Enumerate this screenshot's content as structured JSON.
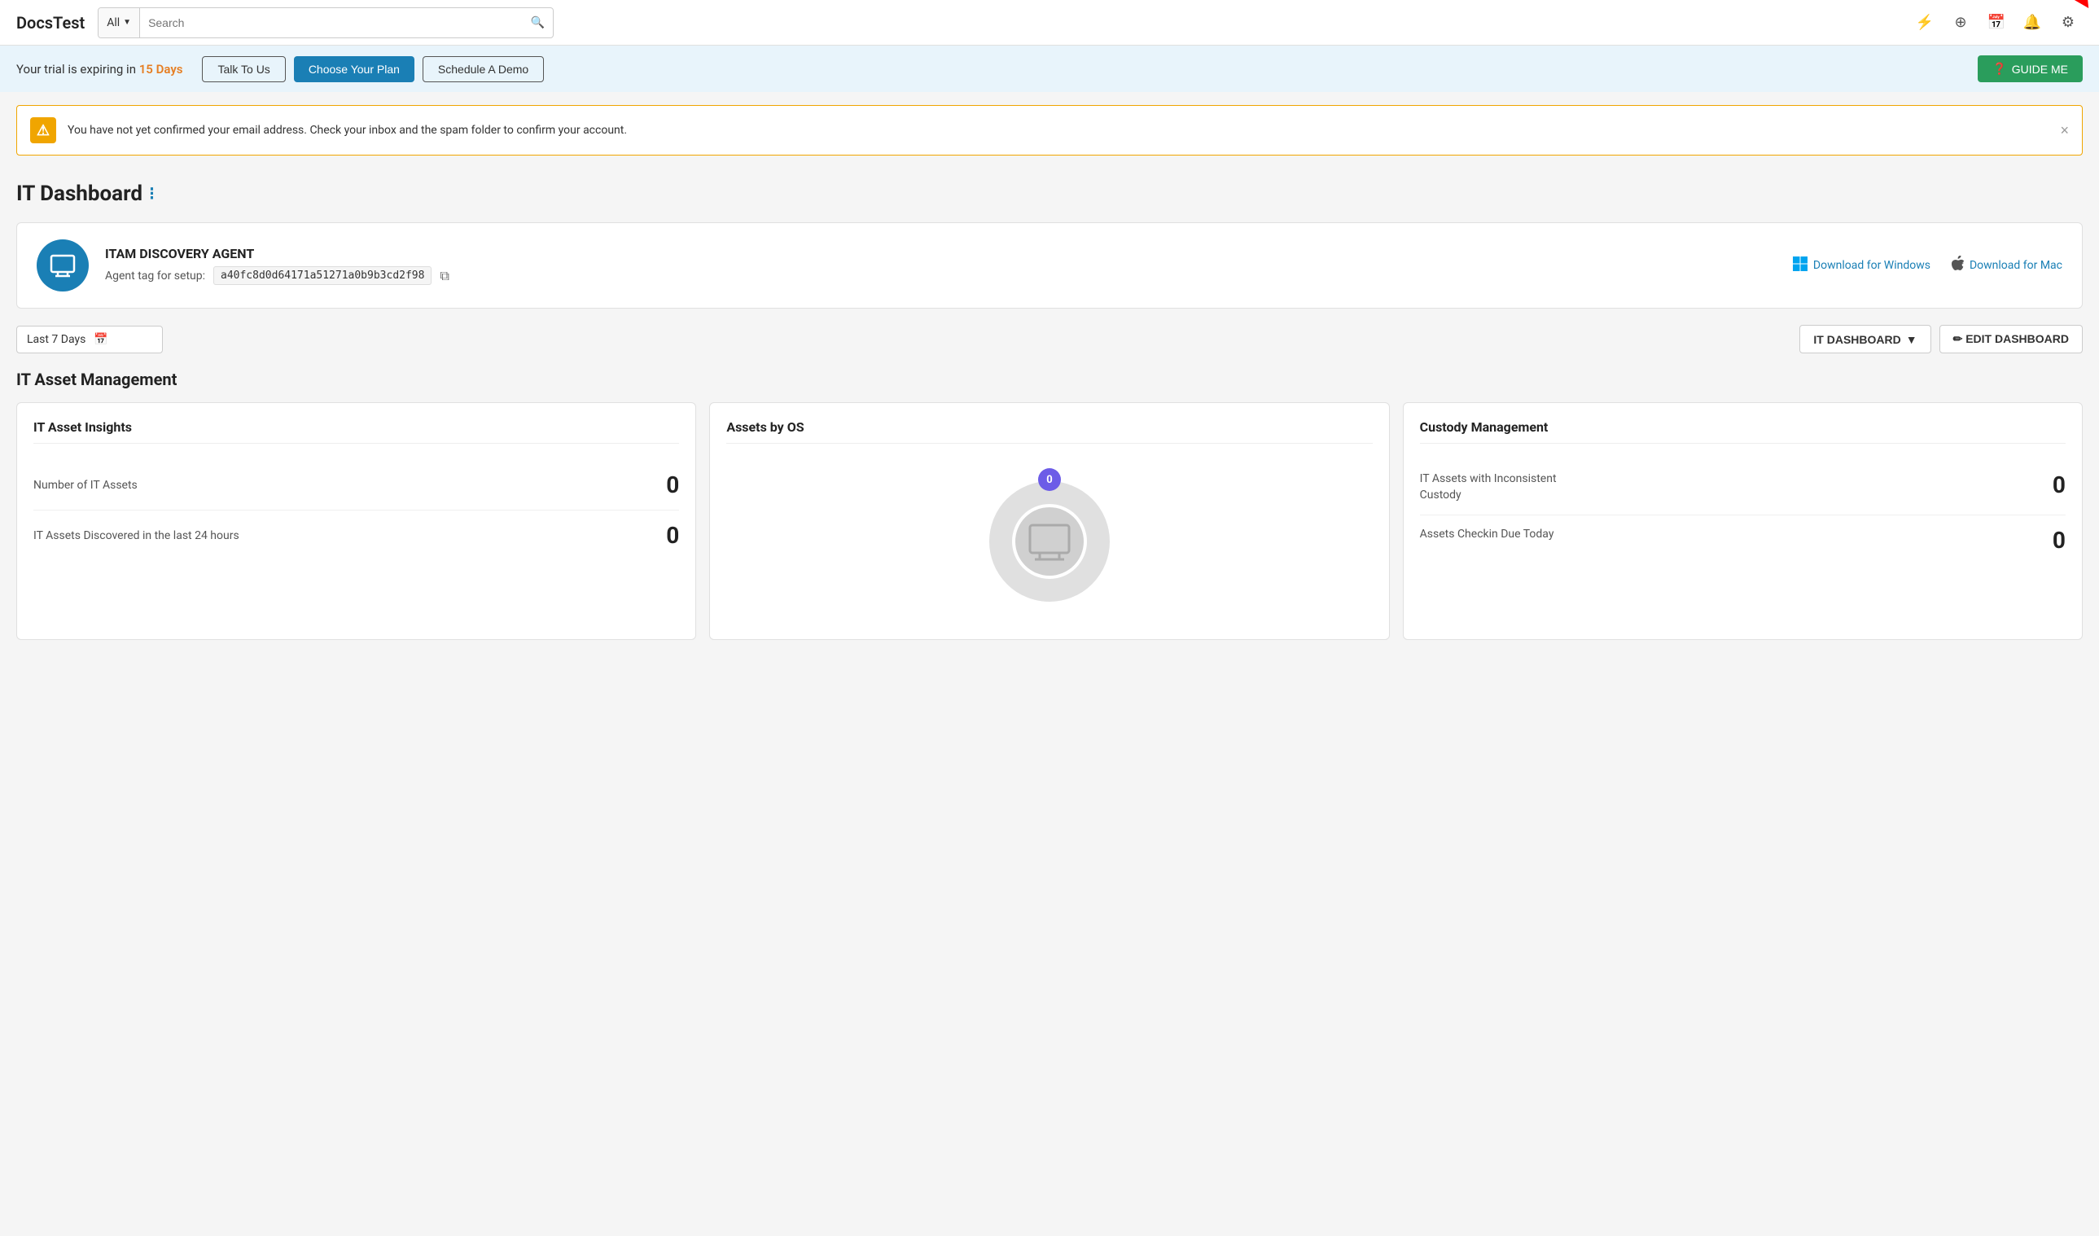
{
  "app": {
    "title": "DocsTest"
  },
  "header": {
    "search_filter_label": "All",
    "search_placeholder": "Search",
    "icons": [
      {
        "name": "lightning-icon",
        "symbol": "⚡"
      },
      {
        "name": "plus-circle-icon",
        "symbol": "⊕"
      },
      {
        "name": "calendar-icon",
        "symbol": "▦"
      },
      {
        "name": "bell-icon",
        "symbol": "🔔"
      },
      {
        "name": "gear-icon",
        "symbol": "⚙"
      }
    ]
  },
  "trial_banner": {
    "text_before": "Your trial is expiring in",
    "days_text": "15 Days",
    "btn_talk": "Talk To Us",
    "btn_choose": "Choose Your Plan",
    "btn_demo": "Schedule A Demo",
    "btn_guide": "GUIDE ME"
  },
  "warning": {
    "message": "You have not yet confirmed your email address. Check your inbox and the spam folder to confirm your account."
  },
  "page": {
    "title": "IT Dashboard",
    "title_dots": "⁝"
  },
  "agent_card": {
    "title": "ITAM DISCOVERY AGENT",
    "tag_label": "Agent tag for setup:",
    "tag_value": "a40fc8d0d64171a51271a0b9b3cd2f98",
    "download_windows": "Download for Windows",
    "download_mac": "Download for Mac"
  },
  "toolbar": {
    "date_filter": "Last 7 Days",
    "dashboard_label": "IT DASHBOARD",
    "edit_label": "✏ EDIT DASHBOARD"
  },
  "asset_management": {
    "section_title": "IT Asset Management",
    "cards": [
      {
        "id": "it-asset-insights",
        "title": "IT Asset Insights",
        "metrics": [
          {
            "label": "Number of IT Assets",
            "value": "0"
          },
          {
            "label": "IT Assets Discovered in the last 24 hours",
            "value": "0"
          }
        ]
      },
      {
        "id": "assets-by-os",
        "title": "Assets by OS",
        "donut_value": "0"
      },
      {
        "id": "custody-management",
        "title": "Custody Management",
        "metrics": [
          {
            "label": "IT Assets with Inconsistent Custody",
            "value": "0"
          },
          {
            "label": "Assets Checkin Due Today",
            "value": "0"
          }
        ]
      }
    ]
  }
}
